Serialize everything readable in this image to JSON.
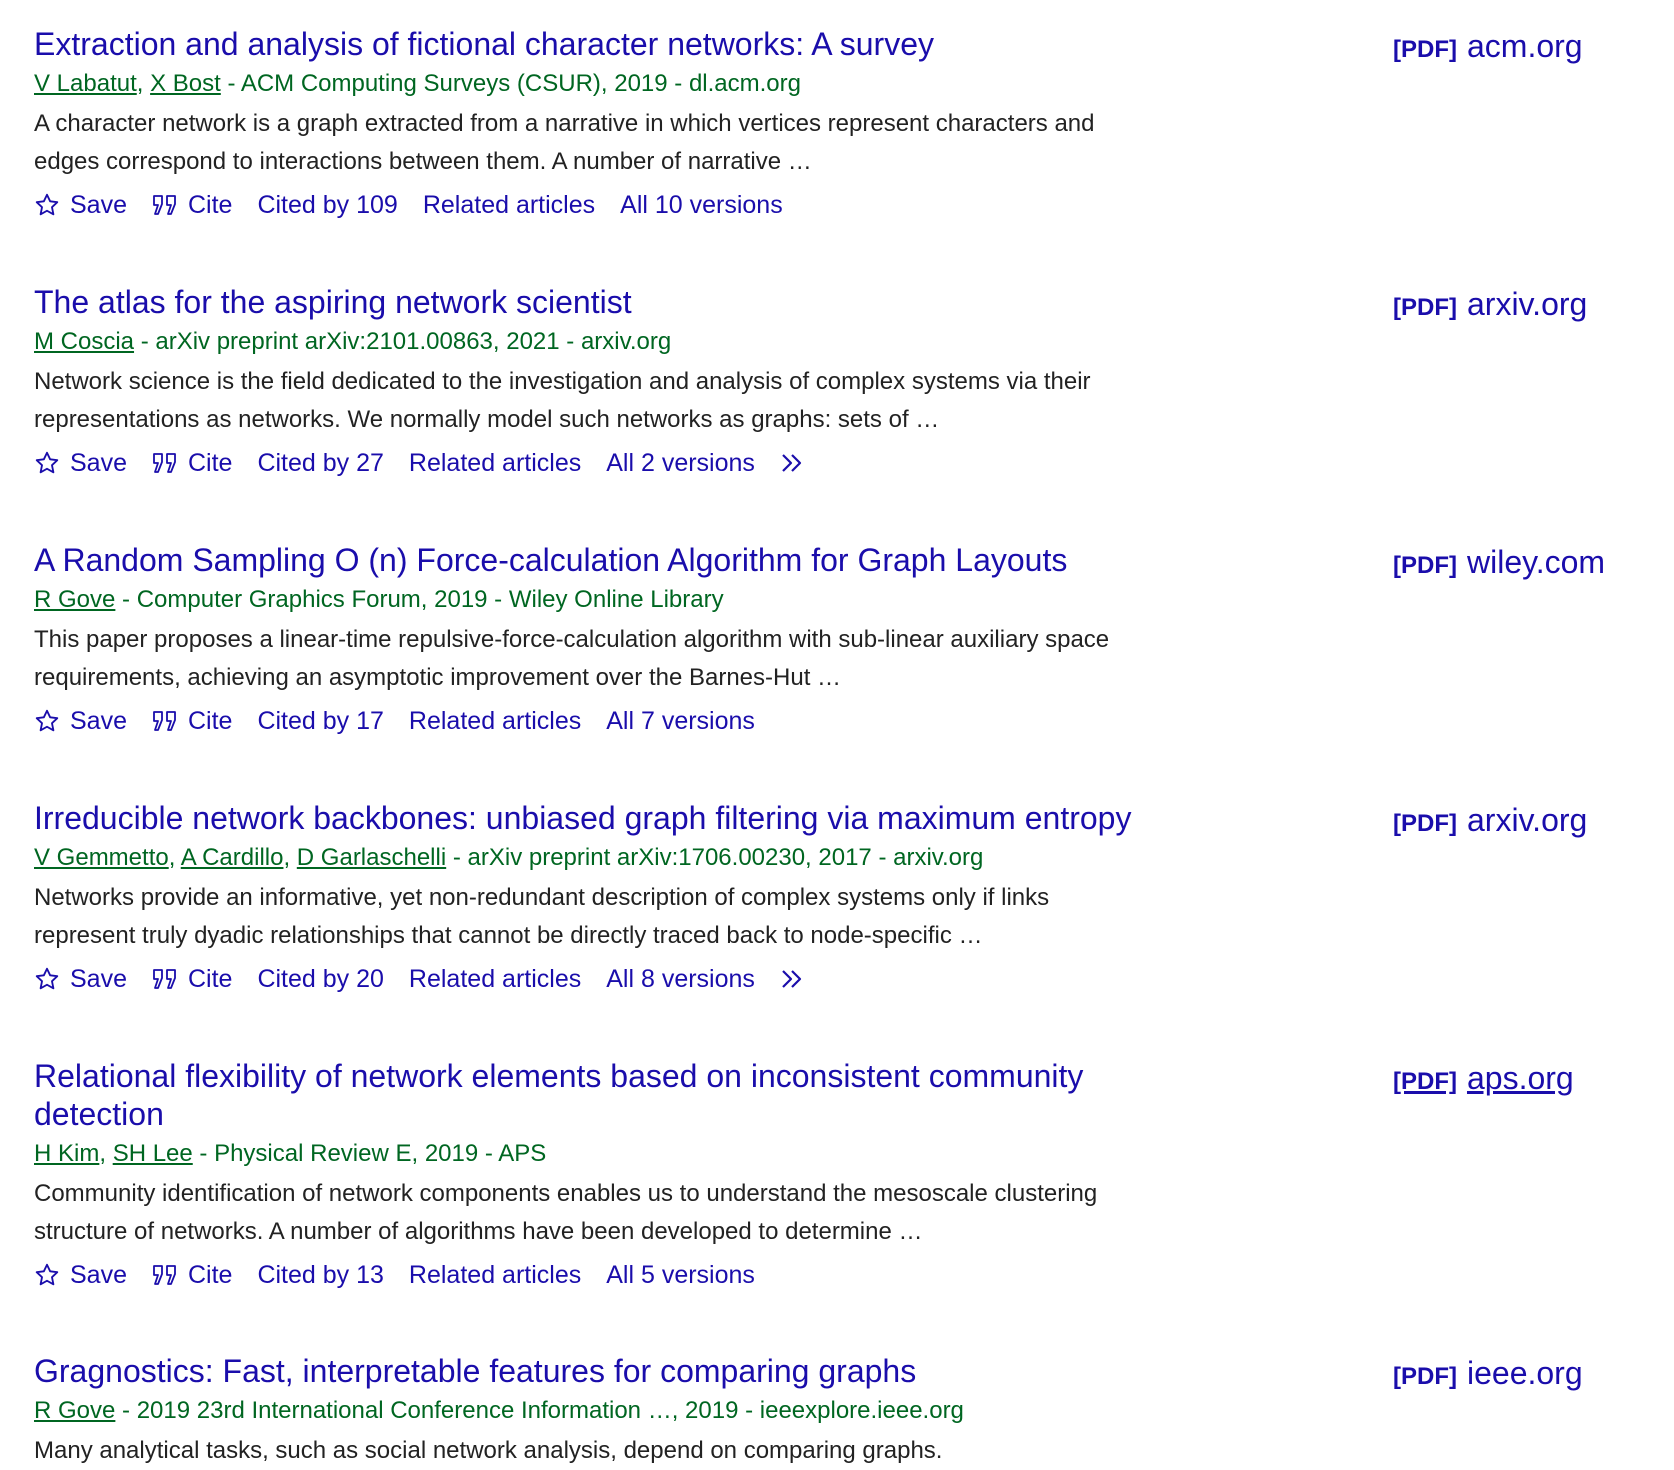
{
  "results": [
    {
      "title": "Extraction and analysis of fictional character networks: A survey",
      "authors": [
        "V Labatut",
        "X Bost"
      ],
      "source": "ACM Computing Surveys (CSUR), 2019",
      "domain": "dl.acm.org",
      "snippet": "A character network is a graph extracted from a narrative in which vertices represent characters and edges correspond to interactions between them. A number of narrative …",
      "pdf_tag": "[PDF]",
      "pdf_domain": "acm.org",
      "save": "Save",
      "cite": "Cite",
      "cited_by": "Cited by 109",
      "related": "Related articles",
      "versions": "All 10 versions"
    },
    {
      "title": "The atlas for the aspiring network scientist",
      "authors": [
        "M Coscia"
      ],
      "source": "arXiv preprint arXiv:2101.00863, 2021",
      "domain": "arxiv.org",
      "snippet": "Network science is the field dedicated to the investigation and analysis of complex systems via their representations as networks. We normally model such networks as graphs: sets of …",
      "pdf_tag": "[PDF]",
      "pdf_domain": "arxiv.org",
      "save": "Save",
      "cite": "Cite",
      "cited_by": "Cited by 27",
      "related": "Related articles",
      "versions": "All 2 versions"
    },
    {
      "title": "A Random Sampling O (n) Force‐calculation Algorithm for Graph Layouts",
      "authors": [
        "R Gove"
      ],
      "source": "Computer Graphics Forum, 2019",
      "domain": "Wiley Online Library",
      "snippet": "This paper proposes a linear‐time repulsive‐force‐calculation algorithm with sub‐linear auxiliary space requirements, achieving an asymptotic improvement over the Barnes‐Hut …",
      "pdf_tag": "[PDF]",
      "pdf_domain": "wiley.com",
      "save": "Save",
      "cite": "Cite",
      "cited_by": "Cited by 17",
      "related": "Related articles",
      "versions": "All 7 versions"
    },
    {
      "title": "Irreducible network backbones: unbiased graph filtering via maximum entropy",
      "authors": [
        "V Gemmetto",
        "A Cardillo",
        "D Garlaschelli"
      ],
      "source": "arXiv preprint arXiv:1706.00230, 2017",
      "domain": "arxiv.org",
      "snippet": "Networks provide an informative, yet non-redundant description of complex systems only if links represent truly dyadic relationships that cannot be directly traced back to node-specific …",
      "pdf_tag": "[PDF]",
      "pdf_domain": "arxiv.org",
      "save": "Save",
      "cite": "Cite",
      "cited_by": "Cited by 20",
      "related": "Related articles",
      "versions": "All 8 versions"
    },
    {
      "title": "Relational flexibility of network elements based on inconsistent community detection",
      "authors": [
        "H Kim",
        "SH Lee"
      ],
      "source": "Physical Review E, 2019",
      "domain": "APS",
      "snippet": "Community identification of network components enables us to understand the mesoscale clustering structure of networks. A number of algorithms have been developed to determine …",
      "pdf_tag": "[PDF]",
      "pdf_domain": "aps.org",
      "save": "Save",
      "cite": "Cite",
      "cited_by": "Cited by 13",
      "related": "Related articles",
      "versions": "All 5 versions"
    },
    {
      "title": "Gragnostics: Fast, interpretable features for comparing graphs",
      "authors": [
        "R Gove"
      ],
      "source": "2019 23rd International Conference Information …, 2019",
      "domain": "ieeexplore.ieee.org",
      "snippet": "Many analytical tasks, such as social network analysis, depend on comparing graphs.",
      "pdf_tag": "[PDF]",
      "pdf_domain": "ieee.org"
    }
  ]
}
